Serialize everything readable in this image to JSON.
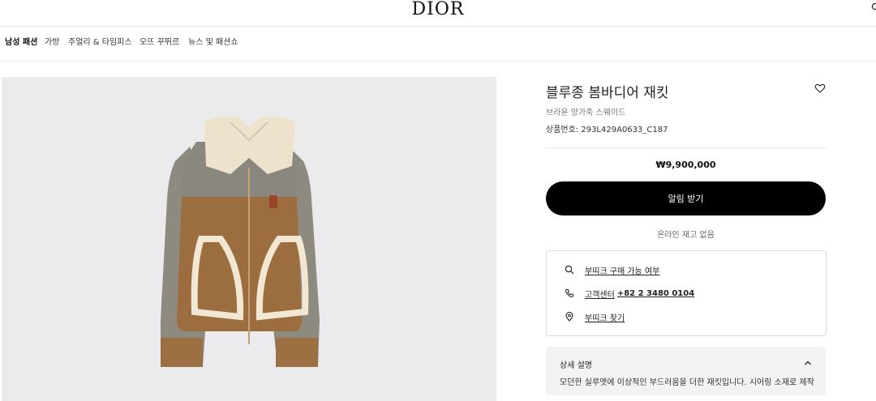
{
  "header": {
    "logo": "DIOR"
  },
  "nav": {
    "items": [
      "남성 패션",
      "가방",
      "주얼리 & 타임피스",
      "오뜨 꾸뛰르",
      "뉴스 및 패션쇼"
    ]
  },
  "product": {
    "title": "블루종 봄바디어 재킷",
    "subtitle": "브라운 양가죽 스웨이드",
    "reference": "상품번호: 293L429A0633_C187",
    "price": "₩9,900,000",
    "notify_label": "알림 받기",
    "stock_status": "온라인 재고 없음"
  },
  "services": {
    "boutique_availability": "부띠크 구매 가능 여부",
    "customer_center_label": "고객센터",
    "customer_center_phone": "+82 2 3480 0104",
    "find_boutique": "부띠크 찾기"
  },
  "details": {
    "title": "상세 설명",
    "body": "모던한 실루엣에 이상적인 부드러움을 더한 재킷입니다. 시어링 소재로 제작"
  },
  "icons": {
    "search": "search-icon",
    "heart": "heart-icon",
    "pin": "map-pin-icon",
    "phone": "phone-icon",
    "chevron": "chevron-up-icon"
  }
}
